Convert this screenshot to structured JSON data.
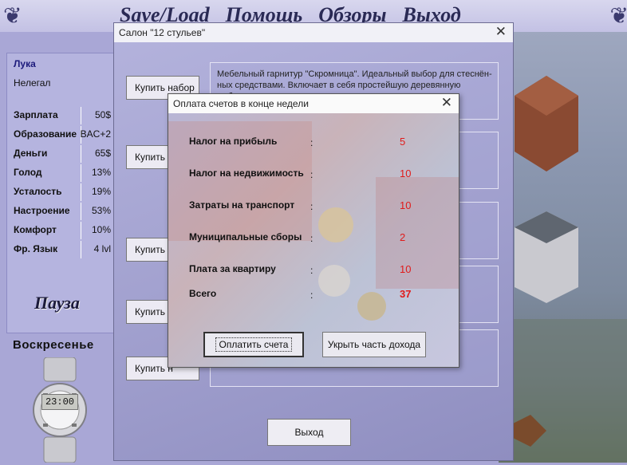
{
  "top_menu": [
    "Save/Load",
    "Помощь",
    "Обзоры",
    "Выход"
  ],
  "player": {
    "name": "Лука",
    "status": "Нелегал",
    "stats": [
      {
        "label": "Зарплата",
        "value": "50$"
      },
      {
        "label": "Образование",
        "value": "BAC+2"
      },
      {
        "label": "Деньги",
        "value": "65$"
      },
      {
        "label": "Голод",
        "value": "13%"
      },
      {
        "label": "Усталость",
        "value": "19%"
      },
      {
        "label": "Настроение",
        "value": "53%"
      },
      {
        "label": "Комфорт",
        "value": "10%"
      },
      {
        "label": "Фр. Язык",
        "value": "4 lvl"
      }
    ],
    "pause_label": "Пауза",
    "day": "Воскресенье",
    "clock": "23:00"
  },
  "salon": {
    "title": "Салон \"12 стульев\"",
    "close": "✕",
    "buy_labels": [
      "Купить набор",
      "Купить н",
      "Купить н",
      "Купить н",
      "Купить н"
    ],
    "item_description": "Мебельный гарнитур \"Скромница\". Идеальный выбор для стеснён-ных средствами. Включает в себя простейшую деревянную мебель.",
    "exit_label": "Выход"
  },
  "dialog": {
    "title": "Оплата счетов в конце недели",
    "close": "✕",
    "bills": [
      {
        "label": "Налог на прибыль",
        "value": "5"
      },
      {
        "label": "Налог на недвижимость",
        "value": "10"
      },
      {
        "label": "Затраты на  транспорт",
        "value": "10"
      },
      {
        "label": "Муниципальные сборы",
        "value": "2"
      },
      {
        "label": "Плата за квартиру",
        "value": "10"
      }
    ],
    "total_label": "Всего",
    "total_value": "37",
    "colon": ":",
    "pay_label": "Оплатить счета",
    "hide_label": "Укрыть часть дохода"
  }
}
